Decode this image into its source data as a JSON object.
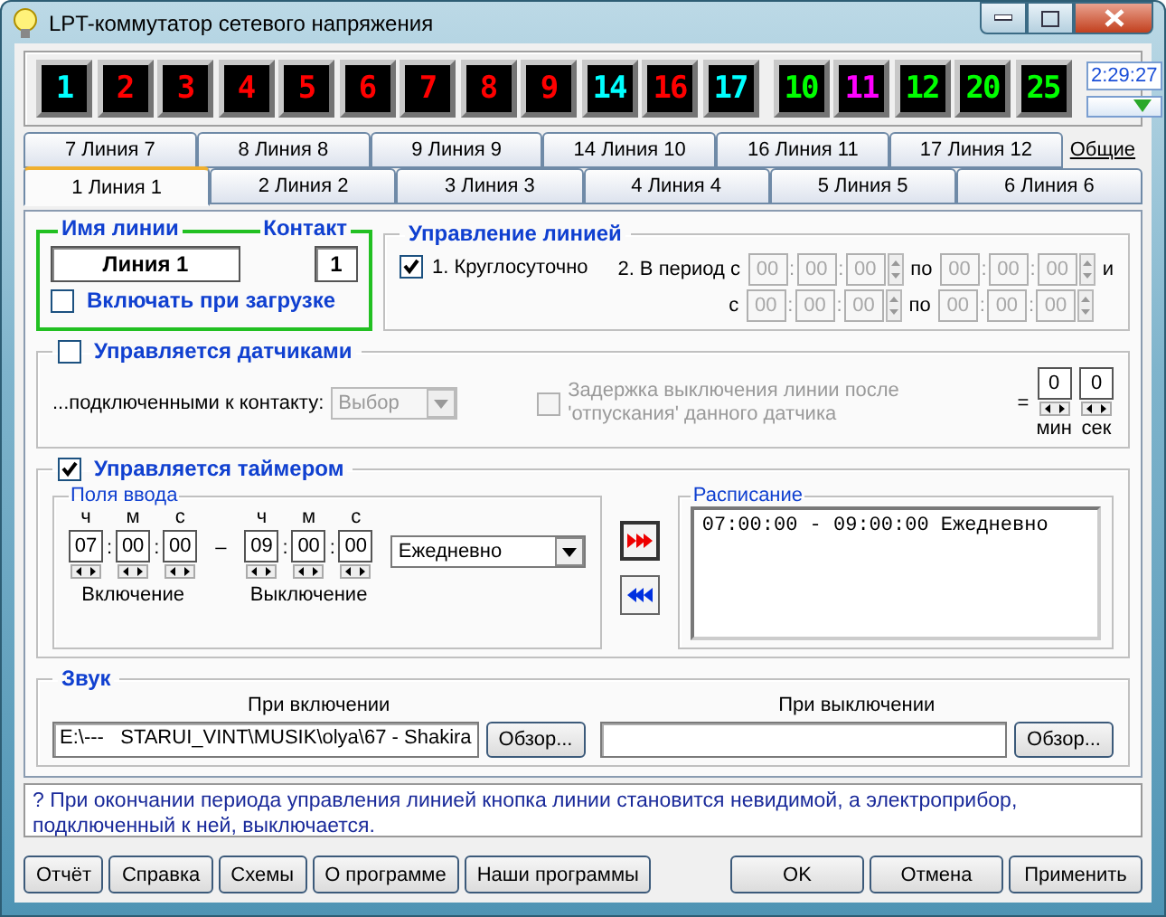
{
  "window": {
    "title": "LPT-коммутатор сетевого напряжения"
  },
  "leds": [
    {
      "label": "1",
      "color": "#00ffff"
    },
    {
      "label": "2",
      "color": "#ff0000"
    },
    {
      "label": "3",
      "color": "#ff0000"
    },
    {
      "label": "4",
      "color": "#ff0000"
    },
    {
      "label": "5",
      "color": "#ff0000"
    },
    {
      "label": "6",
      "color": "#ff0000"
    },
    {
      "label": "7",
      "color": "#ff0000"
    },
    {
      "label": "8",
      "color": "#ff0000"
    },
    {
      "label": "9",
      "color": "#ff0000"
    },
    {
      "label": "14",
      "color": "#00ffff"
    },
    {
      "label": "16",
      "color": "#ff0000"
    },
    {
      "label": "17",
      "color": "#00ffff"
    }
  ],
  "leds_extra": [
    {
      "label": "10",
      "color": "#00ff00"
    },
    {
      "label": "11",
      "color": "#ff00ff"
    },
    {
      "label": "12",
      "color": "#00ff00"
    },
    {
      "label": "20",
      "color": "#00ff00"
    },
    {
      "label": "25",
      "color": "#00ff00"
    }
  ],
  "clock": "2:29:27",
  "tabs_row_1": [
    {
      "label": "7 Линия 7",
      "selected": false,
      "kind": "tab"
    },
    {
      "label": "8 Линия 8",
      "selected": false,
      "kind": "tab"
    },
    {
      "label": "9 Линия 9",
      "selected": false,
      "kind": "tab"
    },
    {
      "label": "14 Линия 10",
      "selected": false,
      "kind": "tab"
    },
    {
      "label": "16 Линия 11",
      "selected": false,
      "kind": "tab"
    },
    {
      "label": "17 Линия 12",
      "selected": false,
      "kind": "tab"
    },
    {
      "label": "Общие",
      "selected": false,
      "kind": "link"
    }
  ],
  "tabs_row_2": [
    {
      "label": "1 Линия 1",
      "selected": true
    },
    {
      "label": "2 Линия 2",
      "selected": false
    },
    {
      "label": "3 Линия 3",
      "selected": false
    },
    {
      "label": "4 Линия 4",
      "selected": false
    },
    {
      "label": "5 Линия 5",
      "selected": false
    },
    {
      "label": "6 Линия 6",
      "selected": false
    }
  ],
  "line_name": {
    "name_label": "Имя линии",
    "name_value": "Линия 1",
    "contact_label": "Контакт",
    "contact_value": "1",
    "autostart": {
      "label": "Включать при загрузке",
      "checked": false
    }
  },
  "line_control": {
    "title": "Управление линией",
    "round_the_clock": {
      "label": "1. Круглосуточно",
      "checked": true
    },
    "periods": [
      {
        "label": "2. В период с",
        "from": [
          "00",
          "00",
          "00"
        ],
        "from_separators": [
          ":",
          ":"
        ],
        "to_label": "по",
        "to": [
          "00",
          "00",
          "00"
        ],
        "to_separators": [
          ":",
          ":"
        ],
        "suffix": "и",
        "disabled": true
      },
      {
        "label": "с",
        "from": [
          "00",
          "00",
          "00"
        ],
        "from_separators": [
          ":",
          ":"
        ],
        "to_label": "по",
        "to": [
          "00",
          "00",
          "00"
        ],
        "to_separators": [
          ":",
          ":"
        ],
        "disabled": true
      }
    ]
  },
  "sensors": {
    "label": "Управляется датчиками",
    "checked": false,
    "contact_label": "...подключенными к контакту:",
    "contact_select": {
      "value": "Выбор",
      "disabled": true
    },
    "delay": {
      "label": "Задержка выключения линии после 'отпускания' данного датчика",
      "checked": false,
      "disabled": true
    },
    "equals": "=",
    "minutes": {
      "value": "0",
      "unit": "мин"
    },
    "seconds": {
      "value": "0",
      "unit": "сек"
    }
  },
  "timer": {
    "label": "Управляется таймером",
    "checked": true,
    "inputs_title": "Поля ввода",
    "on": {
      "units": [
        "ч",
        "м",
        "с"
      ],
      "values": [
        "07",
        "00",
        "00"
      ],
      "separators": [
        ":",
        ":"
      ],
      "caption": "Включение"
    },
    "dash": "–",
    "off": {
      "units": [
        "ч",
        "м",
        "с"
      ],
      "values": [
        "09",
        "00",
        "00"
      ],
      "separators": [
        ":",
        ":"
      ],
      "caption": "Выключение"
    },
    "repeat": "Ежедневно",
    "schedule_title": "Расписание",
    "schedule": [
      "07:00:00 - 09:00:00 Ежедневно"
    ]
  },
  "sound": {
    "title": "Звук",
    "on": {
      "caption": "При включении",
      "path": "E:\\---   STARUI_VINT\\MUSIK\\olya\\67 - Shakira",
      "button": "Обзор..."
    },
    "off": {
      "caption": "При выключении",
      "button": "Обзор..."
    }
  },
  "hint": "? При окончании периода управления линией кнопка линии становится невидимой, а электроприбор, подключенный к ней, выключается.",
  "buttons_left": [
    "Отчёт",
    "Справка",
    "Схемы",
    "О программе",
    "Наши программы"
  ],
  "buttons_right": [
    "OK",
    "Отмена",
    "Применить"
  ]
}
